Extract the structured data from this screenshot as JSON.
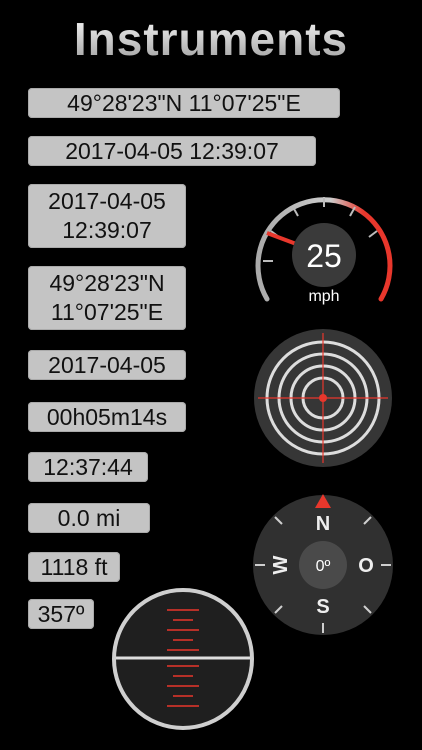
{
  "app": {
    "title": "Instruments"
  },
  "fields": {
    "coords_top": "49°28'23\"N 11°07'25\"E",
    "datetime_top": "2017-04-05 12:39:07",
    "date_small": "2017-04-05",
    "time_small": "12:39:07",
    "lat": "49°28'23\"N",
    "lon": "11°07'25\"E",
    "date": "2017-04-05",
    "duration": "00h05m14s",
    "clock": "12:37:44",
    "distance": "0.0 mi",
    "altitude": "1118 ft",
    "heading": "357º"
  },
  "speedometer": {
    "value": "25",
    "unit": "mph",
    "fraction": 0.2
  },
  "compass": {
    "N": "N",
    "E": "O",
    "S": "S",
    "W": "W",
    "center": "0º"
  },
  "colors": {
    "accent": "#e8372c",
    "label_bg": "#c4c4c4",
    "dial": "#2f2f2f"
  }
}
